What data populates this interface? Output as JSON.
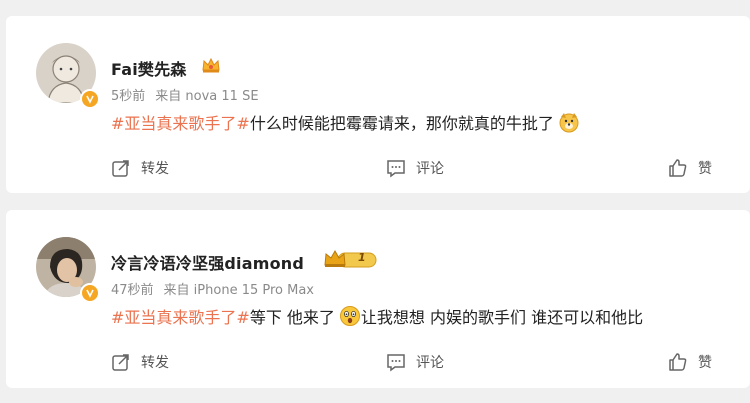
{
  "posts": [
    {
      "username": "Fai樊先森",
      "time": "5秒前",
      "source": "来自 nova 11 SE",
      "hashtag": "#亚当真来歌手了#",
      "text": "什么时候能把霉霉请来，那你就真的牛批了",
      "badge_icon": "crown-icon",
      "emoji": "dog-face-emoji",
      "actions": {
        "repost": "转发",
        "comment": "评论",
        "like": "赞"
      }
    },
    {
      "username": "冷言冷语冷坚强diamond",
      "time": "47秒前",
      "source": "来自 iPhone 15 Pro Max",
      "hashtag": "#亚当真来歌手了#",
      "text_before": "等下 他来了",
      "text_after": " 让我想想 内娱的歌手们 谁还可以和他比",
      "badge_icon": "vip-crown-level-1-icon",
      "vip_level": "1",
      "emoji": "shocked-face-emoji",
      "actions": {
        "repost": "转发",
        "comment": "评论",
        "like": "赞"
      }
    }
  ],
  "colors": {
    "hashtag": "#eb7350",
    "verified": "#f5a623",
    "meta": "#8a8a8a"
  }
}
